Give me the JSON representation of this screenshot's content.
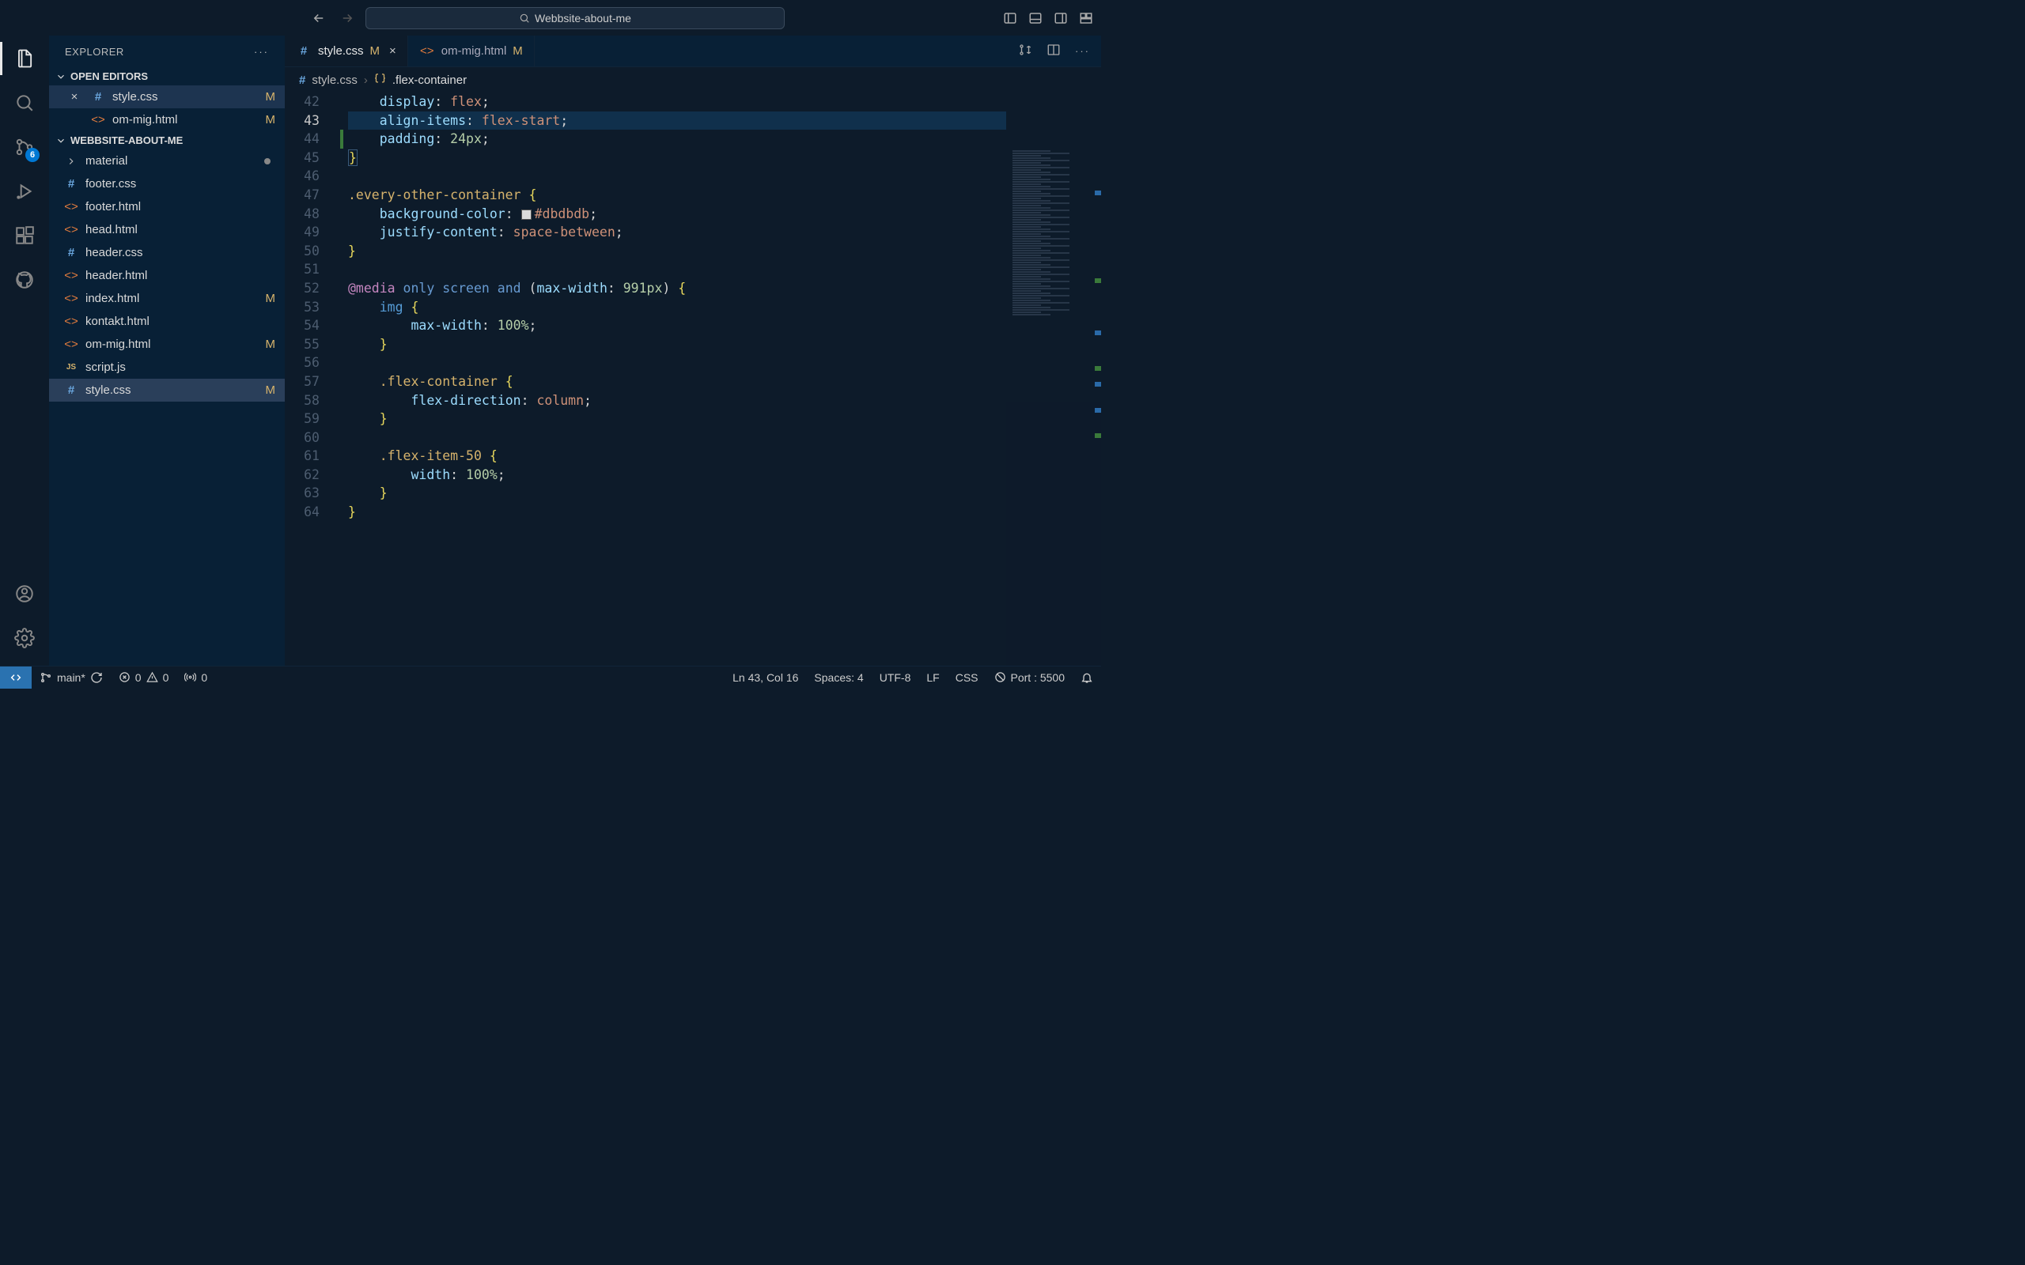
{
  "titlebar": {
    "search": "Webbsite-about-me"
  },
  "activity": {
    "scm_badge": "6"
  },
  "sidebar": {
    "title": "EXPLORER",
    "open_editors_label": "OPEN EDITORS",
    "project_label": "WEBBSITE-ABOUT-ME",
    "open_editors": [
      {
        "name": "style.css",
        "icon": "css",
        "status": "M",
        "closeable": true
      },
      {
        "name": "om-mig.html",
        "icon": "html",
        "status": "M",
        "closeable": false
      }
    ],
    "tree": [
      {
        "name": "material",
        "kind": "folder",
        "dirty": true
      },
      {
        "name": "footer.css",
        "kind": "css"
      },
      {
        "name": "footer.html",
        "kind": "html"
      },
      {
        "name": "head.html",
        "kind": "html"
      },
      {
        "name": "header.css",
        "kind": "css"
      },
      {
        "name": "header.html",
        "kind": "html"
      },
      {
        "name": "index.html",
        "kind": "html",
        "status": "M"
      },
      {
        "name": "kontakt.html",
        "kind": "html"
      },
      {
        "name": "om-mig.html",
        "kind": "html",
        "status": "M"
      },
      {
        "name": "script.js",
        "kind": "js"
      },
      {
        "name": "style.css",
        "kind": "css",
        "status": "M",
        "selected": true
      }
    ]
  },
  "tabs": [
    {
      "name": "style.css",
      "icon": "css",
      "status": "M",
      "active": true,
      "close": true
    },
    {
      "name": "om-mig.html",
      "icon": "html",
      "status": "M",
      "active": false,
      "close": false
    }
  ],
  "breadcrumb": {
    "file": "style.css",
    "symbol": ".flex-container"
  },
  "code": {
    "first_line": 42,
    "highlight_line": 43,
    "lines": [
      {
        "n": 42,
        "html": "    <span class='prop'>display</span><span class='punc'>:</span> <span class='val'>flex</span><span class='punc'>;</span>"
      },
      {
        "n": 43,
        "html": "    <span class='prop'>align-items</span><span class='punc'>:</span> <span class='val'>flex-start</span><span class='punc'>;</span>"
      },
      {
        "n": 44,
        "html": "    <span class='prop'>padding</span><span class='punc'>:</span> <span class='num'>24px</span><span class='punc'>;</span>",
        "mod": true
      },
      {
        "n": 45,
        "html": "<span class='brace bracket-match'>}</span>"
      },
      {
        "n": 46,
        "html": ""
      },
      {
        "n": 47,
        "html": "<span class='sel'>.every-other-container</span> <span class='brace'>{</span>"
      },
      {
        "n": 48,
        "html": "    <span class='prop'>background-color</span><span class='punc'>:</span> <span class='swatch'></span><span class='val'>#dbdbdb</span><span class='punc'>;</span>"
      },
      {
        "n": 49,
        "html": "    <span class='prop'>justify-content</span><span class='punc'>:</span> <span class='val'>space-between</span><span class='punc'>;</span>"
      },
      {
        "n": 50,
        "html": "<span class='brace'>}</span>"
      },
      {
        "n": 51,
        "html": ""
      },
      {
        "n": 52,
        "html": "<span class='media'>@media</span> <span class='mediak'>only</span> <span class='mediak'>screen</span> <span class='mediak'>and</span> <span class='punc'>(</span><span class='prop'>max-width</span><span class='punc'>:</span> <span class='num'>991px</span><span class='punc'>)</span> <span class='brace'>{</span>"
      },
      {
        "n": 53,
        "html": "    <span class='tagn'>img</span> <span class='brace'>{</span>"
      },
      {
        "n": 54,
        "html": "        <span class='prop'>max-width</span><span class='punc'>:</span> <span class='num'>100%</span><span class='punc'>;</span>"
      },
      {
        "n": 55,
        "html": "    <span class='brace'>}</span>"
      },
      {
        "n": 56,
        "html": ""
      },
      {
        "n": 57,
        "html": "    <span class='sel'>.flex-container</span> <span class='brace'>{</span>"
      },
      {
        "n": 58,
        "html": "        <span class='prop'>flex-direction</span><span class='punc'>:</span> <span class='val'>column</span><span class='punc'>;</span>"
      },
      {
        "n": 59,
        "html": "    <span class='brace'>}</span>"
      },
      {
        "n": 60,
        "html": ""
      },
      {
        "n": 61,
        "html": "    <span class='sel'>.flex-item-50</span> <span class='brace'>{</span>"
      },
      {
        "n": 62,
        "html": "        <span class='prop'>width</span><span class='punc'>:</span> <span class='num'>100%</span><span class='punc'>;</span>"
      },
      {
        "n": 63,
        "html": "    <span class='brace'>}</span>"
      },
      {
        "n": 64,
        "html": "<span class='brace'>}</span>"
      }
    ]
  },
  "status": {
    "branch": "main*",
    "errors": "0",
    "warnings": "0",
    "radio": "0",
    "cursor": "Ln 43, Col 16",
    "spaces": "Spaces: 4",
    "encoding": "UTF-8",
    "eol": "LF",
    "lang": "CSS",
    "port": "Port : 5500"
  }
}
